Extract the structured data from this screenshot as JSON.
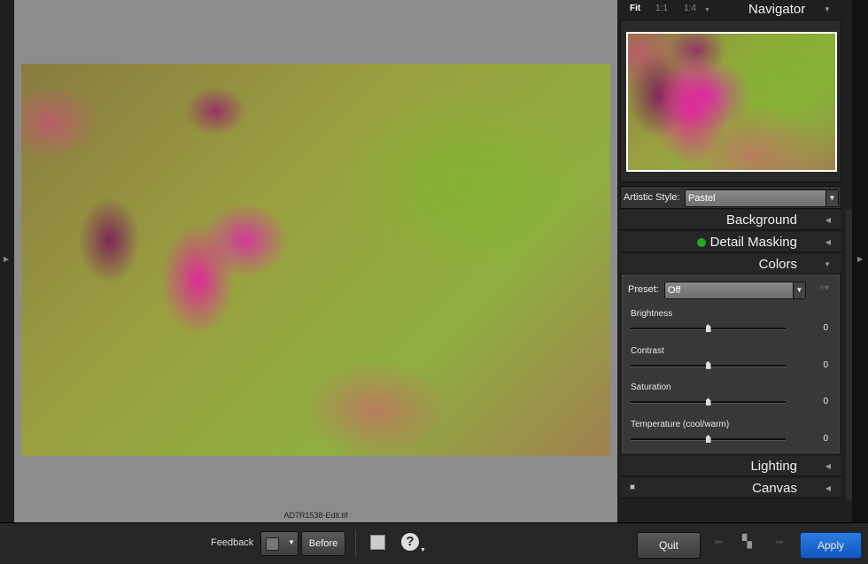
{
  "navigator": {
    "zoom_options": [
      "Fit",
      "1:1",
      "1:4"
    ],
    "title": "Navigator"
  },
  "artistic_style": {
    "label": "Artistic Style:",
    "value": "Pastel"
  },
  "sections": {
    "background": "Background",
    "detail_masking": "Detail Masking",
    "colors": "Colors",
    "lighting": "Lighting",
    "canvas": "Canvas"
  },
  "colors": {
    "preset_label": "Preset:",
    "preset_value": "Off",
    "sliders": [
      {
        "label": "Brightness",
        "value": "0",
        "position": 0.5
      },
      {
        "label": "Contrast",
        "value": "0",
        "position": 0.5
      },
      {
        "label": "Saturation",
        "value": "0",
        "position": 0.5
      },
      {
        "label": "Temperature (cool/warm)",
        "value": "0",
        "position": 0.5
      }
    ]
  },
  "status_color": "#22aa22",
  "filename": "AD7R1538-Edit.tif",
  "bottom": {
    "feedback_label": "Feedback",
    "before_label": "Before",
    "quit_label": "Quit",
    "apply_label": "Apply"
  }
}
